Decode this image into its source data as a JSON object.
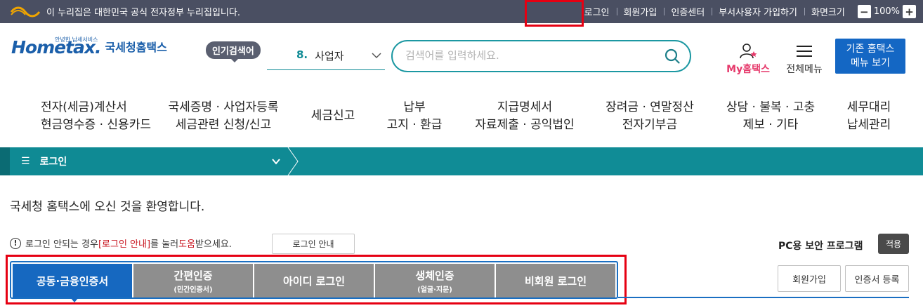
{
  "topbar": {
    "gov_notice": "이 누리집은 대한민국 공식 전자정부 누리집입니다.",
    "links": [
      "로그인",
      "회원가입",
      "인증센터",
      "부서사용자 가입하기",
      "화면크기"
    ],
    "zoom_minus": "−",
    "zoom_value": "100%",
    "zoom_plus": "+"
  },
  "header": {
    "logo_en": "Hometax.",
    "logo_small": "안녕한 납세서비스",
    "logo_kr": "국세청홈택스",
    "popular_label": "인기검색어",
    "rank_num": "8.",
    "rank_term": "사업자",
    "search_placeholder": "검색어를 입력하세요.",
    "my_home": "My홈택스",
    "all_menu": "전체메뉴",
    "old_menu_line1": "기존 홈택스",
    "old_menu_line2": "메뉴 보기"
  },
  "gnb": [
    {
      "line1": "전자(세금)계산서",
      "line2": "현금영수증 · 신용카드"
    },
    {
      "line1": "국세증명 · 사업자등록",
      "line2": "세금관련 신청/신고"
    },
    {
      "line1": "세금신고",
      "line2": ""
    },
    {
      "line1": "납부",
      "line2": "고지 · 환급"
    },
    {
      "line1": "지급명세서",
      "line2": "자료제출 · 공익법인"
    },
    {
      "line1": "장려금 · 연말정산",
      "line2": "전자기부금"
    },
    {
      "line1": "상담 · 불복 · 고충",
      "line2": "제보 · 기타"
    },
    {
      "line1": "세무대리",
      "line2": "납세관리"
    }
  ],
  "location": {
    "current": "로그인"
  },
  "content": {
    "welcome": "국세청 홈택스에 오신 것을 환영합니다.",
    "notice_a": "로그인 안되는 경우 ",
    "notice_b": "[로그인 안내]",
    "notice_c": "를 눌러 ",
    "notice_d": "도움",
    "notice_e": "받으세요.",
    "guide_button": "로그인 안내",
    "pc_security": "PC용 보안 프로그램",
    "apply_button": "적용",
    "tabs": [
      {
        "label": "공동·금융인증서",
        "sub": ""
      },
      {
        "label": "간편인증",
        "sub": "(민간인증서)"
      },
      {
        "label": "아이디 로그인",
        "sub": ""
      },
      {
        "label": "생체인증",
        "sub": "(얼굴·지문)"
      },
      {
        "label": "비회원 로그인",
        "sub": ""
      }
    ],
    "signup_button": "회원가입",
    "cert_register_button": "인증서 등록"
  },
  "colors": {
    "topbar_bg": "#4a4f62",
    "teal": "#108c96",
    "primary_blue": "#1668c0",
    "highlight_red": "#e60012"
  }
}
